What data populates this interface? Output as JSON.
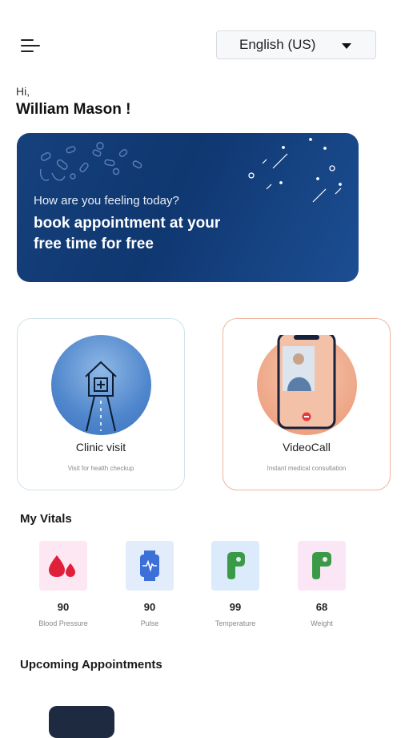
{
  "header": {
    "menu_icon": "hamburger-icon",
    "language": "English (US)",
    "dropdown_icon": "caret-down-icon"
  },
  "greeting": {
    "hi": "Hi,",
    "name": "William Mason !"
  },
  "banner": {
    "question": "How are you feeling today?",
    "line1": "book appointment at your",
    "line2": "free time for free"
  },
  "services": [
    {
      "title": "Clinic visit",
      "subtitle": "Visit for health checkup",
      "icon": "clinic-icon"
    },
    {
      "title": "VideoCall",
      "subtitle": "Instant medical consultation",
      "icon": "video-call-icon"
    }
  ],
  "vitals": {
    "heading": "My Vitals",
    "items": [
      {
        "value": "90",
        "label": "Blood Pressure",
        "icon": "blood-drops-icon",
        "bg": "#fde7f3",
        "color": "#e0203a"
      },
      {
        "value": "90",
        "label": "Pulse",
        "icon": "pulse-watch-icon",
        "bg": "#e3ecfb",
        "color": "#3c6fd8"
      },
      {
        "value": "99",
        "label": "Temperature",
        "icon": "thermometer-icon",
        "bg": "#dcebfb",
        "color": "#3a9a47"
      },
      {
        "value": "68",
        "label": "Weight",
        "icon": "weight-icon",
        "bg": "#fbe6f6",
        "color": "#3a9a47"
      }
    ]
  },
  "appointments": {
    "heading": "Upcoming Appointments"
  }
}
